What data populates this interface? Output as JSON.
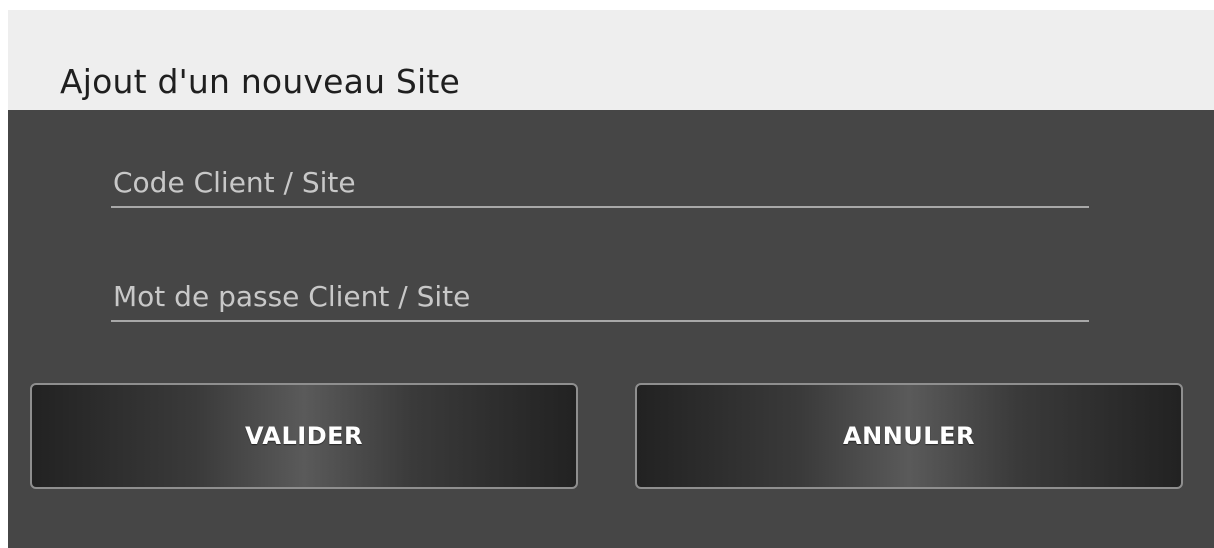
{
  "dialog": {
    "title": "Ajout d'un nouveau Site",
    "fields": {
      "code": {
        "placeholder": "Code Client / Site",
        "value": ""
      },
      "password": {
        "placeholder": "Mot de passe Client / Site",
        "value": ""
      }
    },
    "buttons": {
      "valider_label": "VALIDER",
      "annuler_label": "ANNULER"
    }
  },
  "colors": {
    "header_background": "#eeeeee",
    "body_background": "#464646",
    "title_text": "#1f1f1f",
    "field_text": "#c8c8c8",
    "field_underline": "#a8a8a8",
    "button_border": "#8f8f8f",
    "button_text": "#ffffff"
  }
}
